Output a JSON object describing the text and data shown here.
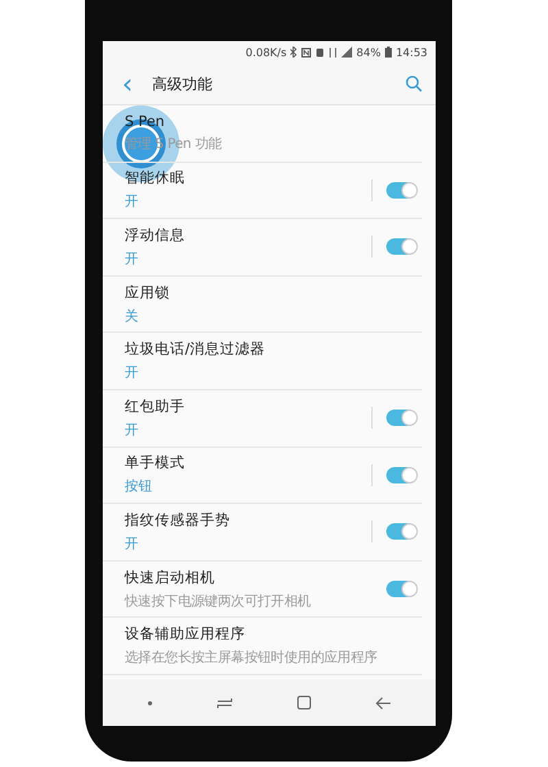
{
  "status_bar": {
    "speed": "0.08K/s",
    "battery": "84%",
    "time": "14:53"
  },
  "header": {
    "back": "‹",
    "title": "高级功能"
  },
  "rows": [
    {
      "kind": "plain",
      "title": "S Pen",
      "subtitle": {
        "kind": "description",
        "text": "管理 S Pen 功能"
      }
    },
    {
      "kind": "switch",
      "title": "智能休眠",
      "subtitle": {
        "kind": "status",
        "text": "开"
      },
      "on": true,
      "divider": true
    },
    {
      "kind": "switch",
      "title": "浮动信息",
      "subtitle": {
        "kind": "status",
        "text": "开"
      },
      "on": true,
      "divider": true
    },
    {
      "kind": "plain",
      "title": "应用锁",
      "subtitle": {
        "kind": "status",
        "text": "关"
      }
    },
    {
      "kind": "plain",
      "title": "垃圾电话/消息过滤器",
      "subtitle": {
        "kind": "status",
        "text": "开"
      }
    },
    {
      "kind": "switch",
      "title": "红包助手",
      "subtitle": {
        "kind": "status",
        "text": "开"
      },
      "on": true,
      "divider": true
    },
    {
      "kind": "switch",
      "title": "单手模式",
      "subtitle": {
        "kind": "status",
        "text": "按钮"
      },
      "on": true,
      "divider": true
    },
    {
      "kind": "switch",
      "title": "指纹传感器手势",
      "subtitle": {
        "kind": "status",
        "text": "开"
      },
      "on": true,
      "divider": true
    },
    {
      "kind": "switch",
      "title": "快速启动相机",
      "subtitle": {
        "kind": "description",
        "text": "快速按下电源键两次可打开相机"
      },
      "on": true,
      "divider": false
    },
    {
      "kind": "plain",
      "title": "设备辅助应用程序",
      "subtitle": {
        "kind": "description",
        "text": "选择在您长按主屏幕按钮时使用的应用程序"
      }
    }
  ]
}
